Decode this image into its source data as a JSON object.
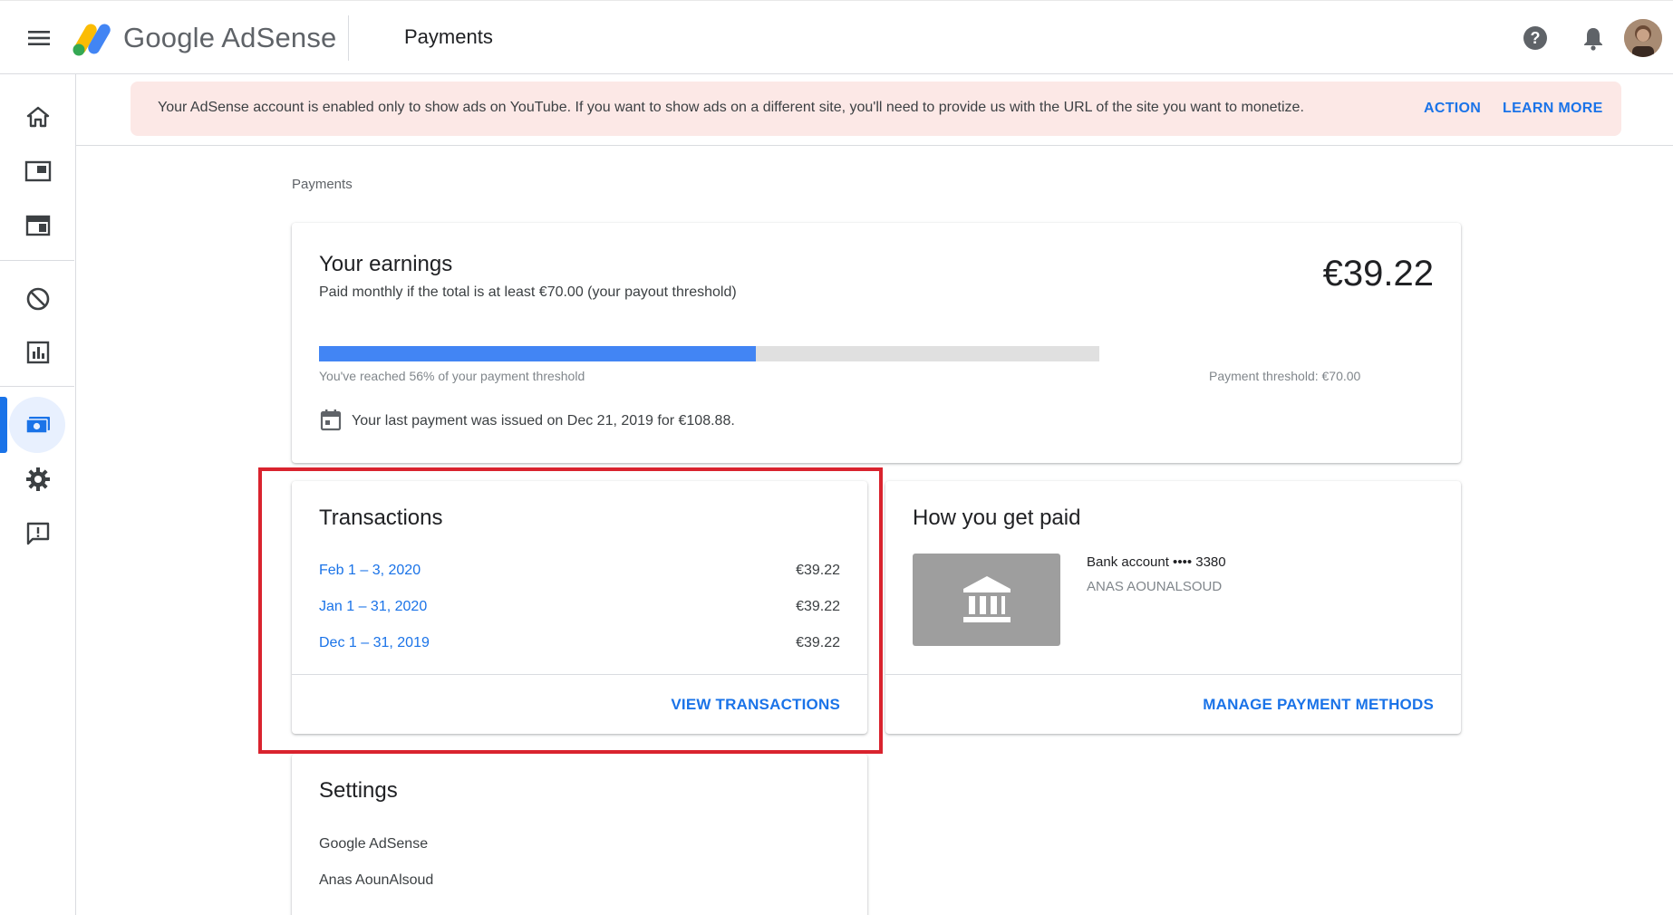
{
  "app": {
    "logo_text": "Google AdSense",
    "page_heading": "Payments"
  },
  "topbar": {
    "icons": [
      "menu-icon",
      "help-icon",
      "notifications-icon",
      "account-avatar"
    ]
  },
  "rail": {
    "items": [
      "home-icon",
      "sites-icon",
      "ads-icon",
      "blocking-controls-icon",
      "reports-icon",
      "payments-icon",
      "settings-icon",
      "feedback-icon"
    ],
    "active": "payments-icon"
  },
  "banner": {
    "text": "Your AdSense account is enabled only to show ads on YouTube. If you want to show ads on a different site, you'll need to provide us with the URL of the site you want to monetize.",
    "action_label": "ACTION",
    "learn_more_label": "LEARN MORE"
  },
  "breadcrumb": "Payments",
  "earnings": {
    "title": "Your earnings",
    "subtitle": "Paid monthly if the total is at least €70.00 (your payout threshold)",
    "amount": "€39.22",
    "progress_fraction": 0.56,
    "progress_label": "You've reached 56% of your payment threshold",
    "threshold_label": "Payment threshold: €70.00",
    "last_payment": "Your last payment was issued on Dec 21, 2019 for €108.88."
  },
  "transactions": {
    "title": "Transactions",
    "rows": [
      {
        "period": "Feb 1 – 3, 2020",
        "amount": "€39.22"
      },
      {
        "period": "Jan 1 – 31, 2020",
        "amount": "€39.22"
      },
      {
        "period": "Dec 1 – 31, 2019",
        "amount": "€39.22"
      }
    ],
    "view_label": "VIEW TRANSACTIONS"
  },
  "payment_method": {
    "title": "How you get paid",
    "bank_account": "Bank account •••• 3380",
    "owner": "ANAS AOUNALSOUD",
    "manage_label": "MANAGE PAYMENT METHODS"
  },
  "settings": {
    "title": "Settings",
    "items": [
      "Google AdSense",
      "Anas AounAlsoud"
    ]
  },
  "colors": {
    "accent": "#1a73e8",
    "progress_fill": "#4285f4",
    "banner_bg": "#fce8e6",
    "highlight": "#d9232e"
  }
}
